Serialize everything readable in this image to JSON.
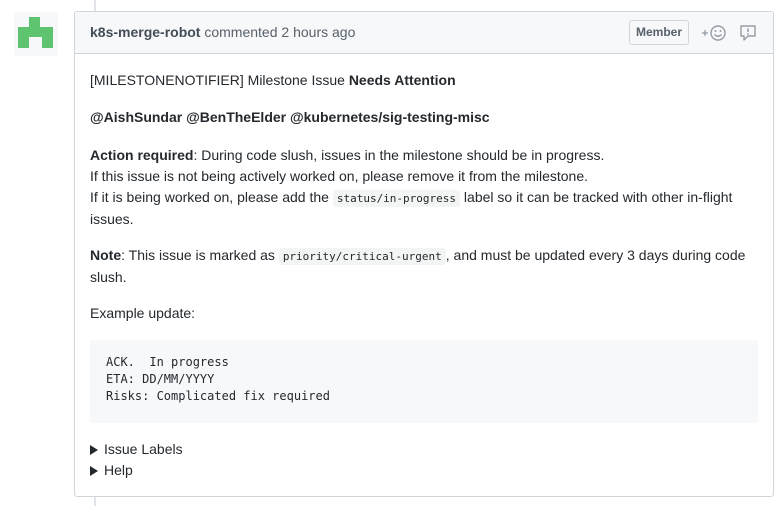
{
  "comment": {
    "author": "k8s-merge-robot",
    "action": "commented",
    "time": "2 hours ago",
    "badge": "Member"
  },
  "icons": {
    "avatar": "identicon-avatar",
    "reaction": "add-reaction-icon",
    "report": "report-icon"
  },
  "colors": {
    "avatar": "#5ec46f",
    "header_bg": "#f6f8fa",
    "border": "#d1d5da"
  },
  "body": {
    "notifier": "[MILESTONENOTIFIER] Milestone Issue ",
    "needs_attention": "Needs Attention",
    "mentions": "@AishSundar @BenTheElder @kubernetes/sig-testing-misc",
    "action_required_label": "Action required",
    "action_required_text": ": During code slush, issues in the milestone should be in progress.",
    "line_not_worked": "If this issue is not being actively worked on, please remove it from the milestone.",
    "line_worked_before": "If it is being worked on, please add the ",
    "status_label": "status/in-progress",
    "line_worked_after": " label so it can be tracked with other in-flight issues.",
    "note_label": "Note",
    "note_before": ": This issue is marked as ",
    "priority_label": "priority/critical-urgent",
    "note_after": ", and must be updated every 3 days during code slush.",
    "example_update": "Example update:",
    "code_lines": [
      "ACK.  In progress",
      "ETA: DD/MM/YYYY",
      "Risks: Complicated fix required"
    ],
    "details": [
      "Issue Labels",
      "Help"
    ]
  }
}
